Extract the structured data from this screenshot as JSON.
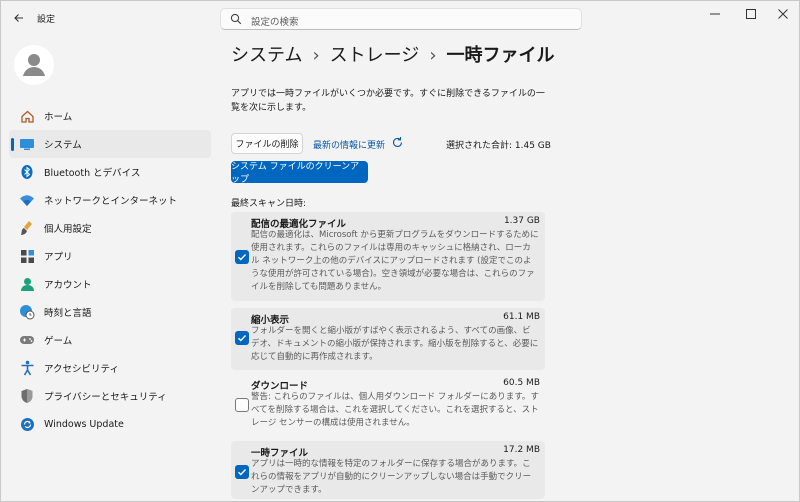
{
  "window": {
    "app_title": "設定",
    "search_placeholder": "設定の検索"
  },
  "sidebar": {
    "items": [
      {
        "label": "ホーム",
        "icon": "home-icon"
      },
      {
        "label": "システム",
        "icon": "system-icon",
        "active": true
      },
      {
        "label": "Bluetooth とデバイス",
        "icon": "bluetooth-icon"
      },
      {
        "label": "ネットワークとインターネット",
        "icon": "wifi-icon"
      },
      {
        "label": "個人用設定",
        "icon": "brush-icon"
      },
      {
        "label": "アプリ",
        "icon": "apps-icon"
      },
      {
        "label": "アカウント",
        "icon": "account-icon"
      },
      {
        "label": "時刻と言語",
        "icon": "globe-clock-icon"
      },
      {
        "label": "ゲーム",
        "icon": "gamepad-icon"
      },
      {
        "label": "アクセシビリティ",
        "icon": "accessibility-icon"
      },
      {
        "label": "プライバシーとセキュリティ",
        "icon": "shield-icon"
      },
      {
        "label": "Windows Update",
        "icon": "update-icon"
      }
    ]
  },
  "main": {
    "breadcrumb": [
      "システム",
      "ストレージ",
      "一時ファイル"
    ],
    "description": "アプリでは一時ファイルがいくつか必要です。すぐに削除できるファイルの一覧を次に示します。",
    "delete_button": "ファイルの削除",
    "refresh_link": "最新の情報に更新",
    "selected_total": "選択された合計: 1.45 GB",
    "cleanup_button": "システム ファイルのクリーンアップ",
    "last_scan": "最終スキャン日時:",
    "items": [
      {
        "title": "配信の最適化ファイル",
        "size": "1.37 GB",
        "checked": true,
        "description": "配信の最適化は、Microsoft から更新プログラムをダウンロードするために使用されます。これらのファイルは専用のキャッシュに格納され、ローカル ネットワーク上の他のデバイスにアップロードされます (設定でこのような使用が許可されている場合)。空き領域が必要な場合は、これらのファイルを削除しても問題ありません。"
      },
      {
        "title": "縮小表示",
        "size": "61.1 MB",
        "checked": true,
        "description": "フォルダーを開くと縮小版がすばやく表示されるよう、すべての画像、ビデオ、ドキュメントの縮小版が保持されます。縮小版を削除すると、必要に応じて自動的に再作成されます。"
      },
      {
        "title": "ダウンロード",
        "size": "60.5 MB",
        "checked": false,
        "description": "警告: これらのファイルは、個人用ダウンロード フォルダーにあります。すべてを削除する場合は、これを選択してください。これを選択すると、ストレージ センサーの構成は使用されません。"
      },
      {
        "title": "一時ファイル",
        "size": "17.2 MB",
        "checked": true,
        "description": "アプリは一時的な情報を特定のフォルダーに保存する場合があります。これらの情報をアプリが自動的にクリーンアップしない場合は手動でクリーンアップできます。"
      }
    ]
  },
  "colors": {
    "accent": "#0067c0",
    "background": "#f3f3f3",
    "card": "#e9e9e9"
  }
}
